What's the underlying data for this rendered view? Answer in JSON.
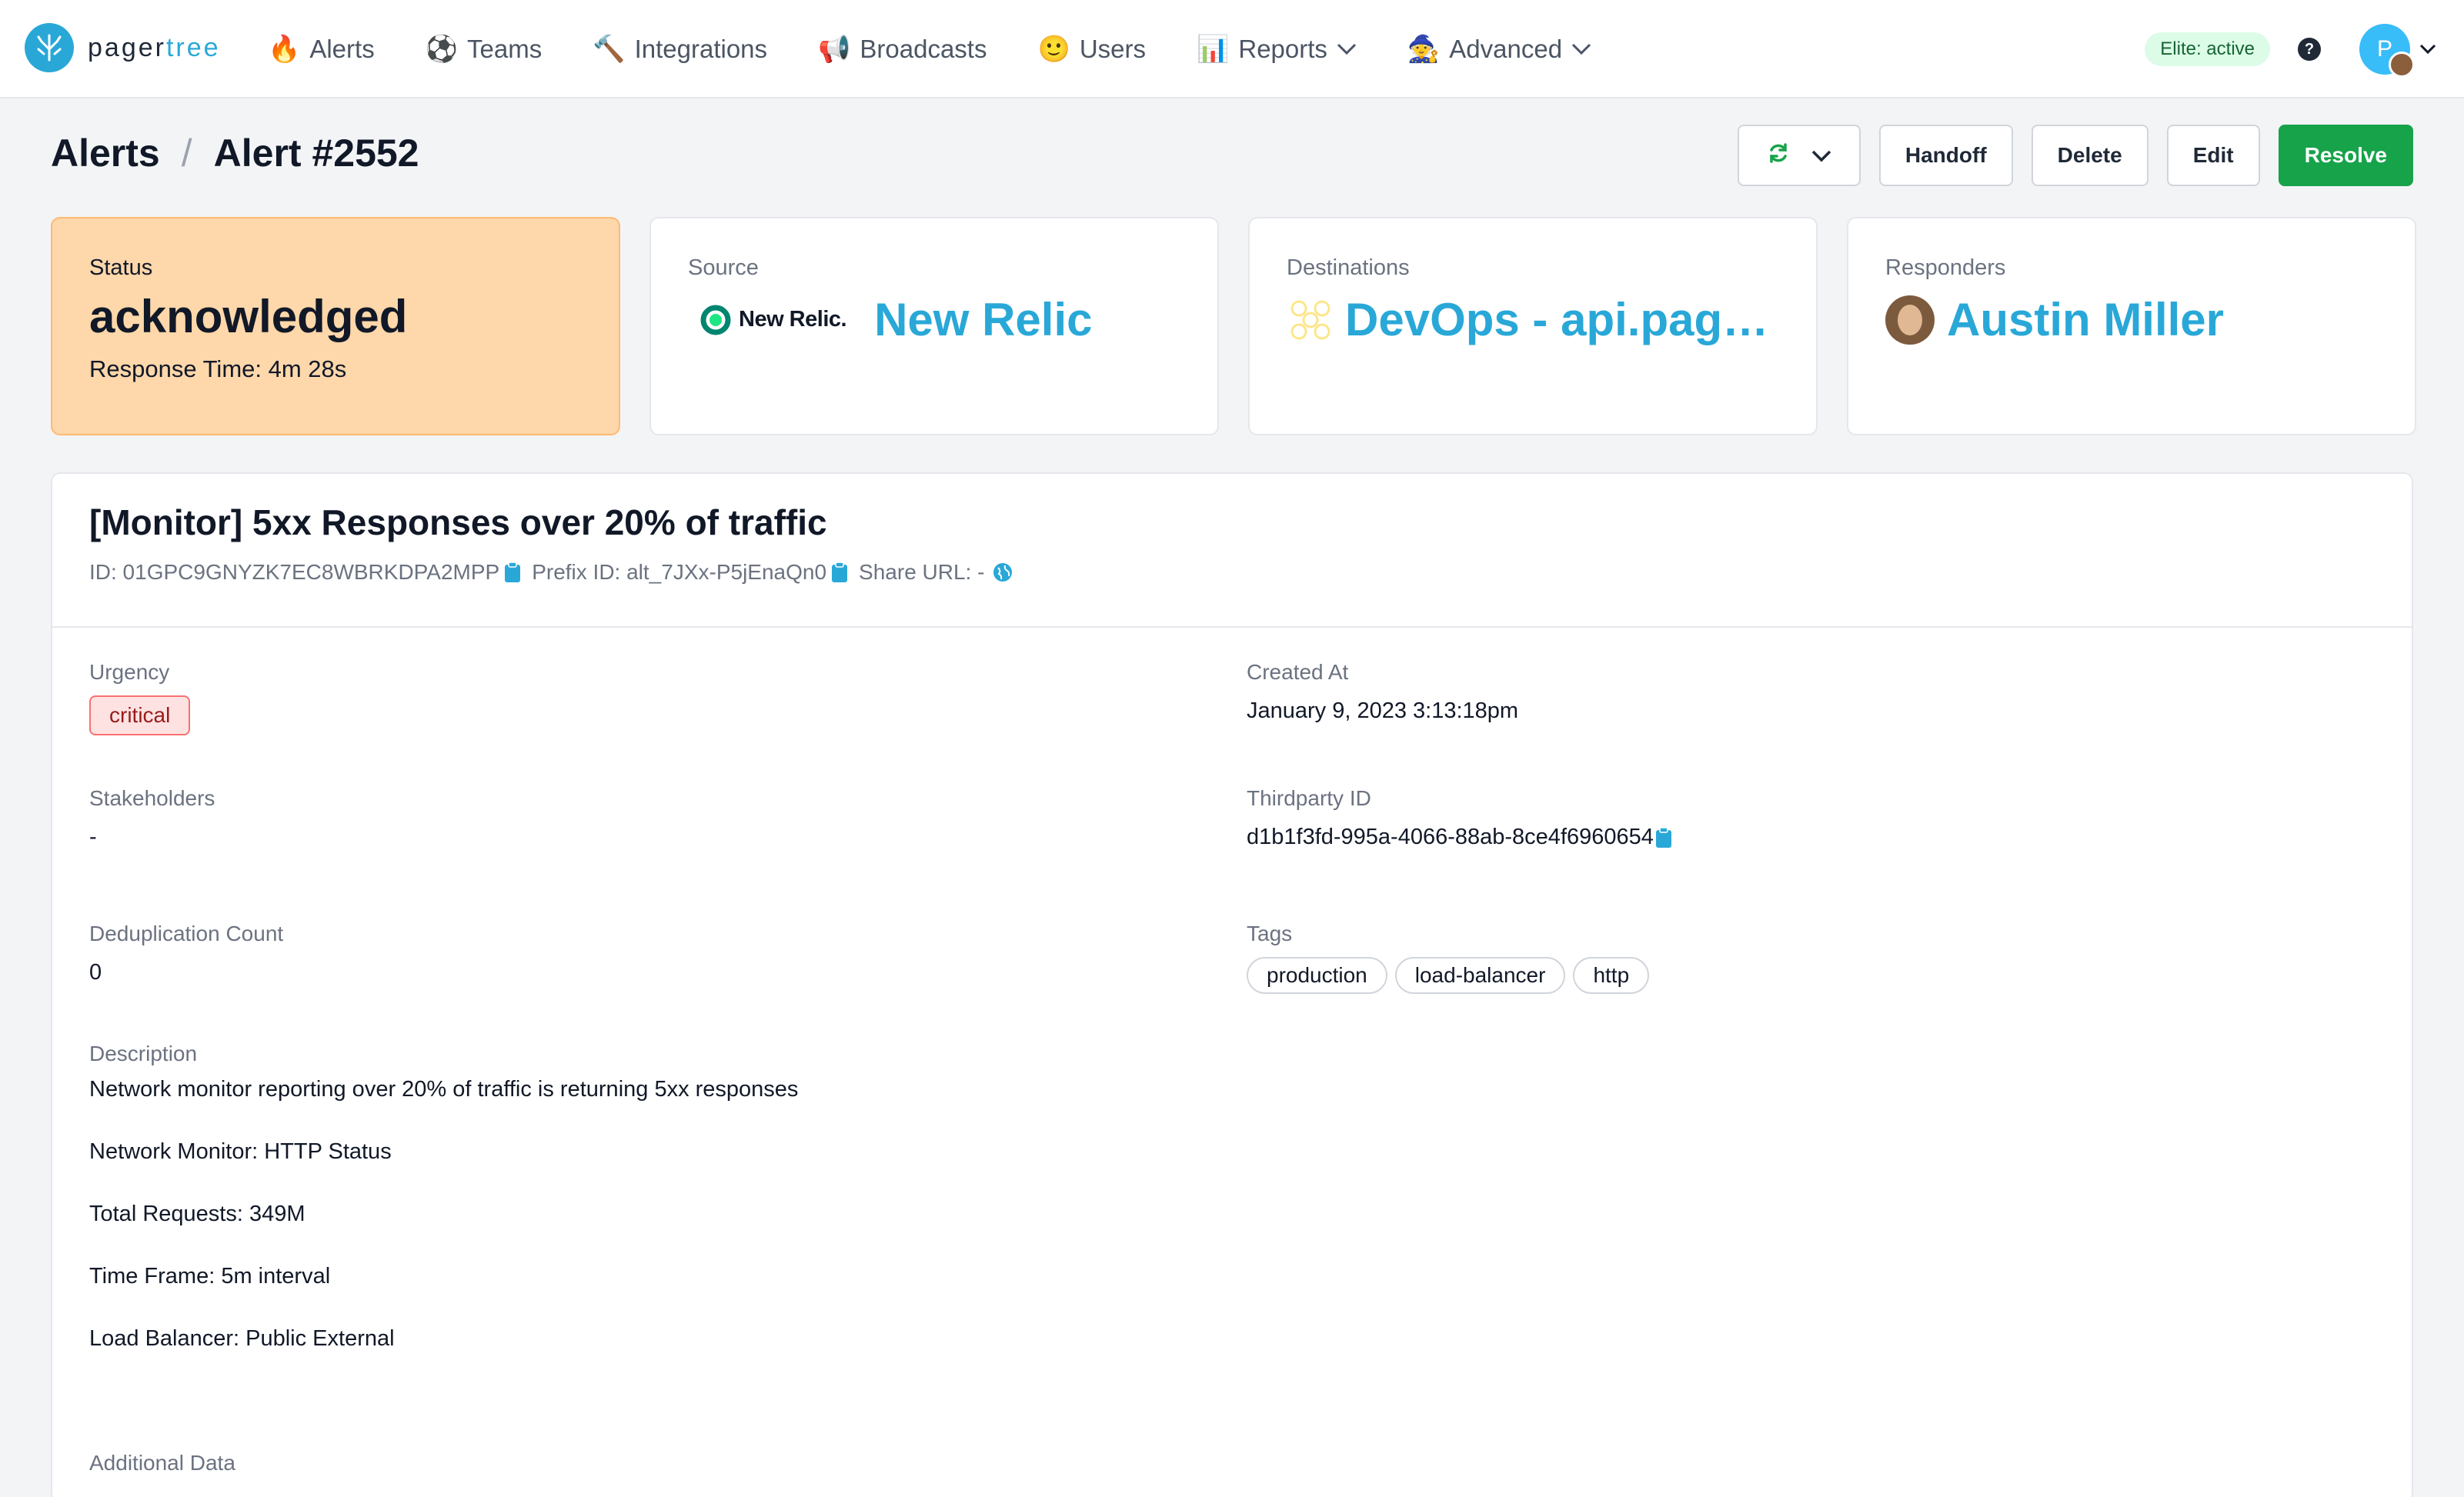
{
  "brand": {
    "name_part1": "pager",
    "name_part2": "tree"
  },
  "nav": {
    "items": [
      {
        "label": "Alerts",
        "icon": "🔥"
      },
      {
        "label": "Teams",
        "icon": "⚽"
      },
      {
        "label": "Integrations",
        "icon": "🔨"
      },
      {
        "label": "Broadcasts",
        "icon": "📢"
      },
      {
        "label": "Users",
        "icon": "🙂"
      },
      {
        "label": "Reports",
        "icon": "📊"
      },
      {
        "label": "Advanced",
        "icon": "🧙"
      }
    ],
    "plan_badge": "Elite: active",
    "help": "?",
    "avatar_initial": "P"
  },
  "breadcrumb": {
    "root": "Alerts",
    "separator": "/",
    "current": "Alert #2552"
  },
  "actions": {
    "handoff": "Handoff",
    "delete": "Delete",
    "edit": "Edit",
    "resolve": "Resolve"
  },
  "cards": {
    "status": {
      "label": "Status",
      "value": "acknowledged",
      "response_time": "Response Time: 4m 28s"
    },
    "source": {
      "label": "Source",
      "logo_text": "New Relic.",
      "value": "New Relic"
    },
    "destinations": {
      "label": "Destinations",
      "value": "DevOps - api.pagertree.com"
    },
    "responders": {
      "label": "Responders",
      "value": "Austin Miller"
    }
  },
  "alert": {
    "title": "[Monitor] 5xx Responses over 20% of traffic",
    "id": "ID: 01GPC9GNYZK7EC8WBRKDPA2MPP",
    "prefix_id": "Prefix ID: alt_7JXx-P5jEnaQn0",
    "share_url": "Share URL: -"
  },
  "fields": {
    "urgency": {
      "label": "Urgency",
      "value": "critical"
    },
    "created_at": {
      "label": "Created At",
      "value": "January 9, 2023 3:13:18pm"
    },
    "stakeholders": {
      "label": "Stakeholders",
      "value": "-"
    },
    "thirdparty": {
      "label": "Thirdparty ID",
      "value": "d1b1f3fd-995a-4066-88ab-8ce4f6960654"
    },
    "dedup": {
      "label": "Deduplication Count",
      "value": "0"
    },
    "tags": {
      "label": "Tags",
      "items": [
        "production",
        "load-balancer",
        "http"
      ]
    },
    "description": {
      "label": "Description",
      "lines": [
        "Network monitor reporting over 20% of traffic is returning 5xx responses",
        "Network Monitor: HTTP Status",
        "Total Requests: 349M",
        "Time Frame: 5m interval",
        "Load Balancer: Public External"
      ]
    },
    "additional": {
      "label": "Additional Data"
    }
  },
  "colors": {
    "accent": "#29a8d8",
    "resolve": "#16a34a",
    "status_bg": "#fed7aa"
  }
}
